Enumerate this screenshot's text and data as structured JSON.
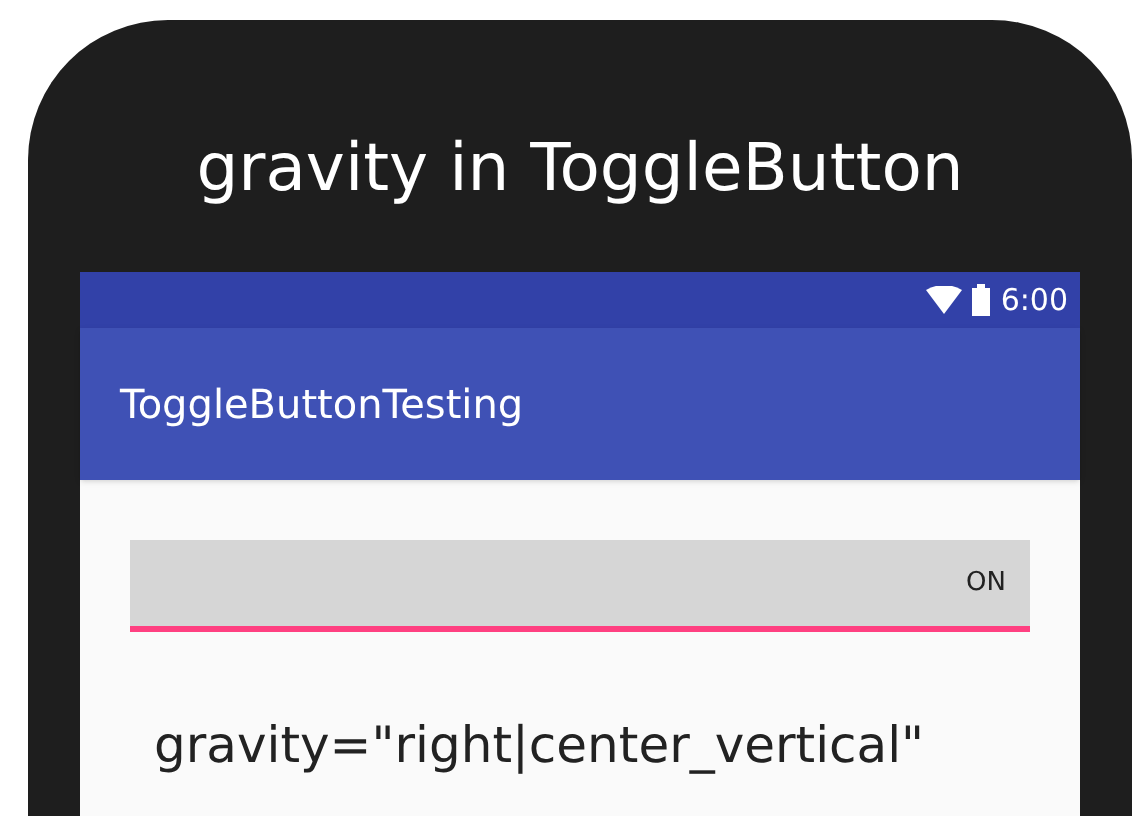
{
  "heading": "gravity in ToggleButton",
  "status_bar": {
    "time": "6:00"
  },
  "app_bar": {
    "title": "ToggleButtonTesting"
  },
  "toggle_button": {
    "text": "ON",
    "checked": true
  },
  "caption": "gravity=\"right|center_vertical\""
}
